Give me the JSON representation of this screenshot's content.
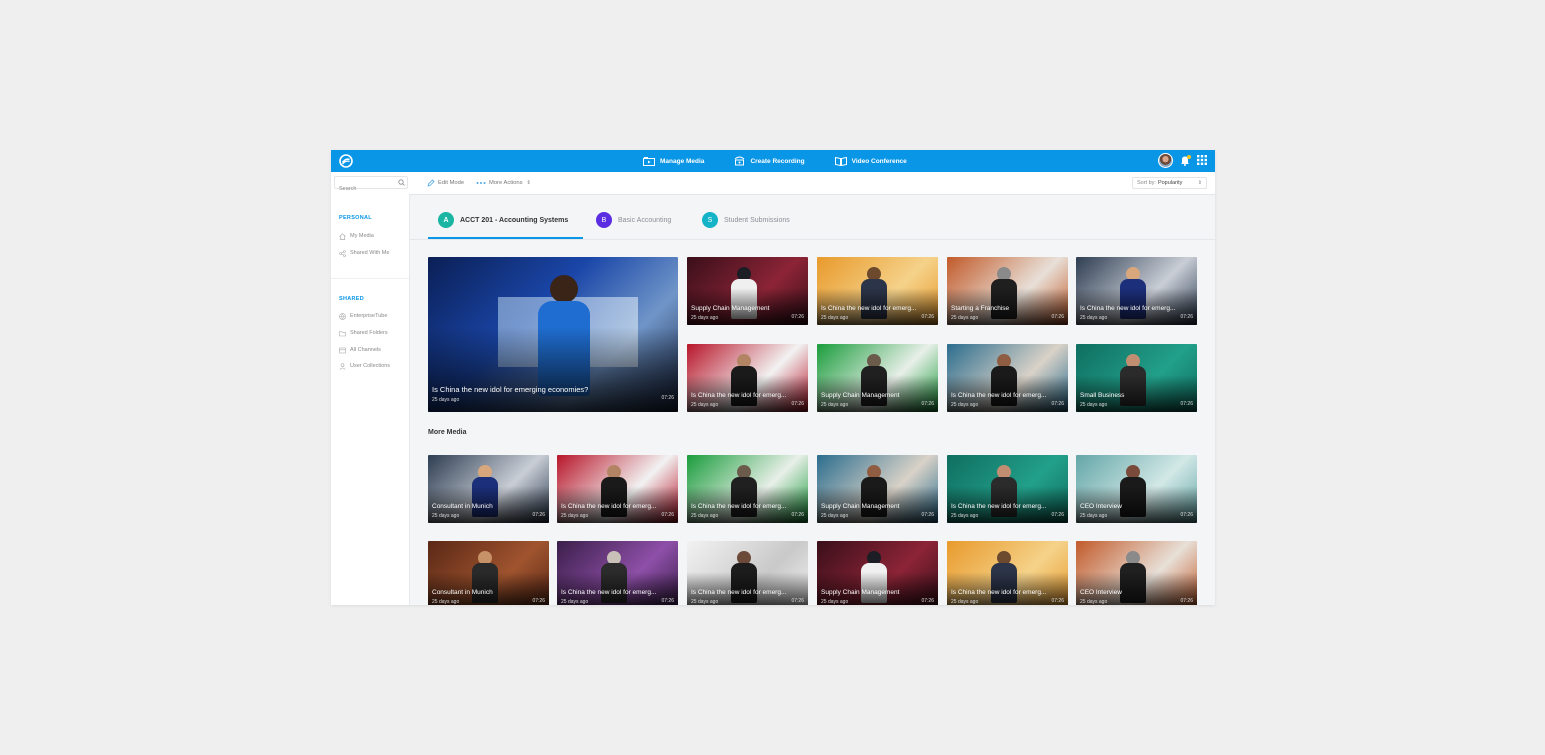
{
  "topbar": {
    "nav": [
      {
        "label": "Manage Media",
        "icon": "media-folder-icon"
      },
      {
        "label": "Create Recording",
        "icon": "recording-icon"
      },
      {
        "label": "Video Conference",
        "icon": "book-icon"
      }
    ]
  },
  "toolbar": {
    "search_placeholder": "Search",
    "edit_mode": "Edit Mode",
    "more_actions": "More Actions",
    "sort_label": "Sort by:",
    "sort_value": "Popularity"
  },
  "sidebar": {
    "personal_title": "PERSONAL",
    "personal": [
      "My Media",
      "Shared With Me"
    ],
    "shared_title": "SHARED",
    "shared": [
      "EnterpriseTube",
      "Shared Folders",
      "All Channels",
      "User Collections"
    ]
  },
  "tabs": [
    {
      "letter": "A",
      "label": "ACCT 201 - Accounting Systems",
      "color": "#1bb5a3"
    },
    {
      "letter": "B",
      "label": "Basic Accounting",
      "color": "#5a2de0"
    },
    {
      "letter": "S",
      "label": "Student Submissions",
      "color": "#14b3c8"
    }
  ],
  "featured": {
    "title": "Is China the new idol for emerging economies?",
    "date": "25 days ago",
    "duration": "07:26"
  },
  "course_tiles": [
    {
      "title": "Supply Chain Management",
      "date": "25 days ago",
      "duration": "07:26"
    },
    {
      "title": "Is China the new idol for emerg...",
      "date": "25 days ago",
      "duration": "07:26"
    },
    {
      "title": "Starting a Franchise",
      "date": "25 days ago",
      "duration": "07:26"
    },
    {
      "title": "Is China the new idol for emerg...",
      "date": "25 days ago",
      "duration": "07:26"
    },
    {
      "title": "Is China the new idol for emerg...",
      "date": "25 days ago",
      "duration": "07:26"
    },
    {
      "title": "Supply Chain Management",
      "date": "25 days ago",
      "duration": "07:26"
    },
    {
      "title": "Is China the new idol for emerg...",
      "date": "25 days ago",
      "duration": "07:26"
    },
    {
      "title": "Small Business",
      "date": "25 days ago",
      "duration": "07:26"
    }
  ],
  "more_media_title": "More Media",
  "more_media": [
    {
      "title": "Consultant in Munich",
      "date": "25 days ago",
      "duration": "07:26"
    },
    {
      "title": "Is China the new idol for emerg...",
      "date": "25 days ago",
      "duration": "07:26"
    },
    {
      "title": "Is China the new idol for emerg...",
      "date": "25 days ago",
      "duration": "07:26"
    },
    {
      "title": "Supply Chain Management",
      "date": "25 days ago",
      "duration": "07:26"
    },
    {
      "title": "Is China the new idol for emerg...",
      "date": "25 days ago",
      "duration": "07:26"
    },
    {
      "title": "CEO Interview",
      "date": "25 days ago",
      "duration": "07:26"
    },
    {
      "title": "Consultant in Munich",
      "date": "25 days ago",
      "duration": "07:26"
    },
    {
      "title": "Is China the new idol for emerg...",
      "date": "25 days ago",
      "duration": "07:26"
    },
    {
      "title": "Is China the new idol for emerg...",
      "date": "25 days ago",
      "duration": "07:26"
    },
    {
      "title": "Supply Chain Management",
      "date": "25 days ago",
      "duration": "07:26"
    },
    {
      "title": "Is China the new idol for emerg...",
      "date": "25 days ago",
      "duration": "07:26"
    },
    {
      "title": "CEO Interview",
      "date": "25 days ago",
      "duration": "07:26"
    }
  ]
}
